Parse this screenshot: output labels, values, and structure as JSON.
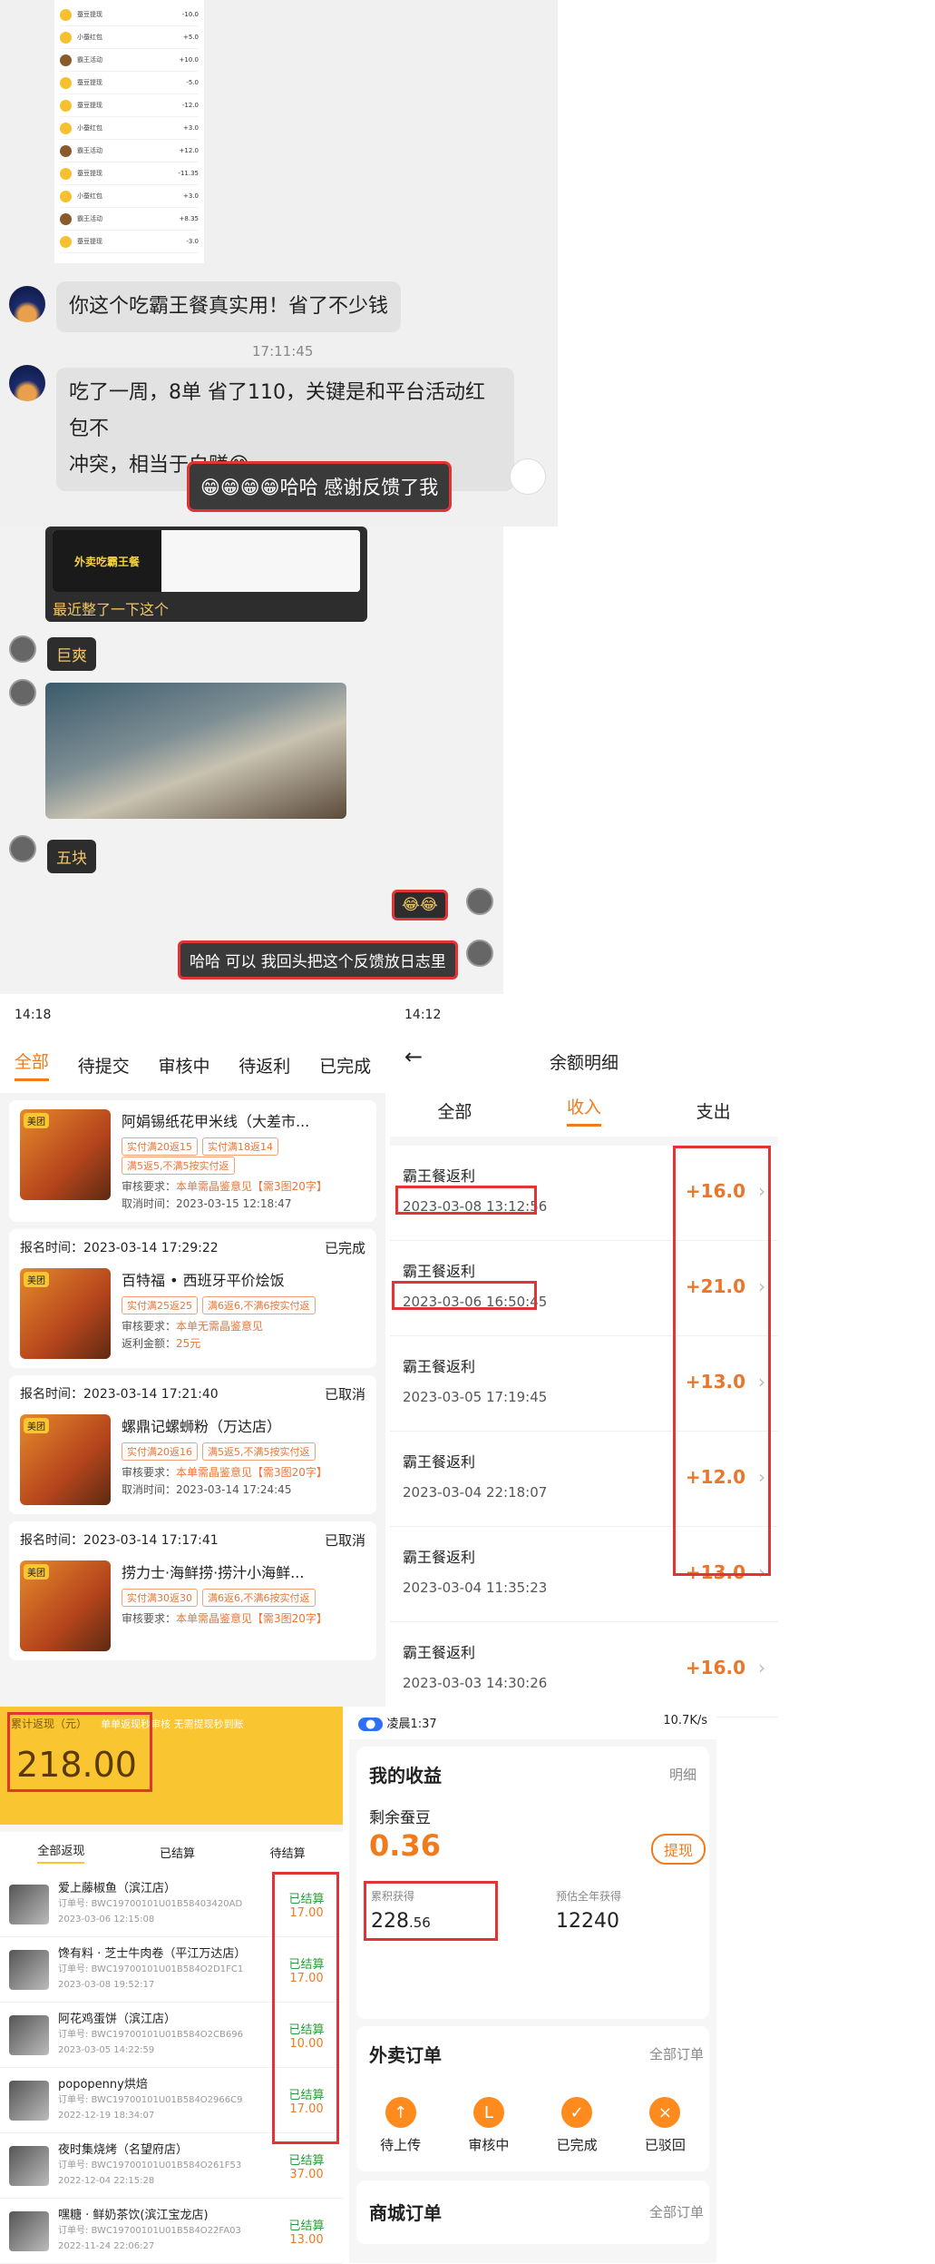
{
  "chat1": {
    "mini_rows": [
      {
        "label": "蚕豆提现",
        "amount": "-10.0"
      },
      {
        "label": "小蚕红包",
        "amount": "+5.0"
      },
      {
        "label": "霸王活动",
        "amount": "+10.0"
      },
      {
        "label": "蚕豆提现",
        "amount": "-5.0"
      },
      {
        "label": "蚕豆提现",
        "amount": "-12.0"
      },
      {
        "label": "小蚕红包",
        "amount": "+3.0"
      },
      {
        "label": "霸王活动",
        "amount": "+12.0"
      },
      {
        "label": "蚕豆提现",
        "amount": "-11.35"
      },
      {
        "label": "小蚕红包",
        "amount": "+3.0"
      },
      {
        "label": "霸王活动",
        "amount": "+8.35"
      },
      {
        "label": "蚕豆提现",
        "amount": "-3.0"
      }
    ],
    "msg1": "你这个吃霸王餐真实用！省了不少钱",
    "time": "17:11:45",
    "msg2_line1": "吃了一周，8单 省了110，关键是和平台活动红包不",
    "msg2_line2": "冲突，相当于白赚😁",
    "reply": "😁😁😁😁哈哈 感谢反馈了我"
  },
  "chat2": {
    "card_caption": "最近整了一下这个",
    "card_inner": "外卖吃霸王餐",
    "msg_a": "巨爽",
    "msg_b": "五块",
    "reply_emoji": "😂😂",
    "reply_text": "哈哈 可以 我回头把这个反馈放日志里"
  },
  "orders": {
    "status_time": "14:18",
    "tabs": [
      "全部",
      "待提交",
      "审核中",
      "待返利",
      "已完成"
    ],
    "cards": [
      {
        "header": "",
        "status": "",
        "name": "阿娟锡纸花甲米线（大差市...",
        "tags": [
          "实付满20返15",
          "实付满18返14",
          "满5返5,不满5按实付返"
        ],
        "l1": "审核要求：",
        "l1v": "本单需晶鉴意见【需3图20字】",
        "l2": "取消时间：2023-03-15 12:18:47",
        "badge": "美团"
      },
      {
        "header": "报名时间：2023-03-14 17:29:22",
        "status": "已完成",
        "name": "百特福 • 西班牙平价烩饭",
        "tags": [
          "实付满25返25",
          "满6返6,不满6按实付返"
        ],
        "l1": "审核要求：",
        "l1v": "本单无需晶鉴意见",
        "l2": "返利金额：",
        "l2v": "25元",
        "badge": "美团"
      },
      {
        "header": "报名时间：2023-03-14 17:21:40",
        "status": "已取消",
        "name": "螺鼎记螺蛳粉（万达店）",
        "tags": [
          "实付满20返16",
          "满5返5,不满5按实付返"
        ],
        "l1": "审核要求：",
        "l1v": "本单需晶鉴意见【需3图20字】",
        "l2": "取消时间：2023-03-14 17:24:45",
        "badge": "美团"
      },
      {
        "header": "报名时间：2023-03-14 17:17:41",
        "status": "已取消",
        "name": "捞力士·海鲜捞·捞汁小海鲜...",
        "tags": [
          "实付满30返30",
          "满6返6,不满6按实付返"
        ],
        "l1": "审核要求：",
        "l1v": "本单需晶鉴意见【需3图20字】",
        "badge": "美团"
      }
    ]
  },
  "balance": {
    "status_time": "14:12",
    "title": "余额明细",
    "tabs": [
      "全部",
      "收入",
      "支出"
    ],
    "rows": [
      {
        "t": "霸王餐返利",
        "d": "2023-03-08 13:12:56",
        "v": "+16.0"
      },
      {
        "t": "霸王餐返利",
        "d": "2023-03-06 16:50:45",
        "v": "+21.0"
      },
      {
        "t": "霸王餐返利",
        "d": "2023-03-05 17:19:45",
        "v": "+13.0"
      },
      {
        "t": "霸王餐返利",
        "d": "2023-03-04 22:18:07",
        "v": "+12.0"
      },
      {
        "t": "霸王餐返利",
        "d": "2023-03-04 11:35:23",
        "v": "+13.0"
      },
      {
        "t": "霸王餐返利",
        "d": "2023-03-03 14:30:26",
        "v": "+16.0"
      }
    ]
  },
  "rebate": {
    "label": "累计返现（元）",
    "banner": "单单返现秒审核 无需提现秒到账",
    "amount": "218.00",
    "tabs": [
      "全部返现",
      "已结算",
      "待结算"
    ],
    "items": [
      {
        "n": "爱上藤椒鱼（滨江店）",
        "o": "订单号: BWC19700101U01B58403420AD",
        "dt": "2023-03-06 12:15:08",
        "s": "已结算",
        "a": "17.00"
      },
      {
        "n": "馋有料 · 芝士牛肉卷（平江万达店）",
        "o": "订单号: BWC19700101U01B584O2D1FC1",
        "dt": "2023-03-08 19:52:17",
        "s": "已结算",
        "a": "17.00"
      },
      {
        "n": "阿花鸡蛋饼（滨江店）",
        "o": "订单号: BWC19700101U01B584O2CB696",
        "dt": "2023-03-05 14:22:59",
        "s": "已结算",
        "a": "10.00"
      },
      {
        "n": "popopenny烘焙",
        "o": "订单号: BWC19700101U01B584O2966C9",
        "dt": "2022-12-19 18:34:07",
        "s": "已结算",
        "a": "17.00"
      },
      {
        "n": "夜时集烧烤（名望府店）",
        "o": "订单号: BWC19700101U01B584O261F53",
        "dt": "2022-12-04 22:15:28",
        "s": "已结算",
        "a": "37.00"
      },
      {
        "n": "嘿糖 · 鲜奶茶饮(滨江宝龙店)",
        "o": "订单号: BWC19700101U01B584O22FA03",
        "dt": "2022-11-24 22:06:27",
        "s": "已结算",
        "a": "13.00"
      }
    ]
  },
  "earnings": {
    "status_time": "凌晨1:37",
    "net": "10.7K/s",
    "title": "我的收益",
    "detail": "明细",
    "remain_label": "剩余蚕豆",
    "remain": "0.36",
    "withdraw": "提现",
    "total_label": "累积获得",
    "total_int": "228",
    "total_dec": ".56",
    "year_label": "预估全年获得",
    "year": "12240",
    "section1": "外卖订单",
    "all_orders": "全部订单",
    "icons": [
      "待上传",
      "审核中",
      "已完成",
      "已驳回"
    ],
    "section2": "商城订单",
    "all_orders2": "全部订单"
  },
  "colors": {
    "accent": "#f07b1d",
    "highlight": "#e23434",
    "rebate_yellow": "#f9c531"
  }
}
